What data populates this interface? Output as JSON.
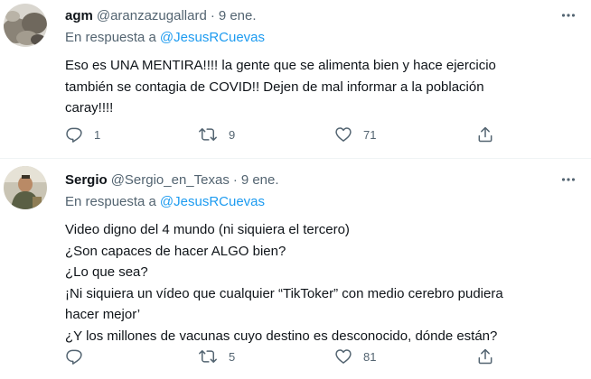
{
  "tweets": [
    {
      "name": "agm",
      "handle": "@aranzazugallard",
      "separator": "·",
      "date": "9 ene.",
      "reply_prefix": "En respuesta a",
      "reply_to": "@JesusRCuevas",
      "text": "Eso es UNA MENTIRA!!!! la gente que se alimenta bien y hace ejercicio\ntambién se contagia de COVID!! Dejen de mal informar a la población\ncaray!!!!",
      "replies": "1",
      "retweets": "9",
      "likes": "71",
      "icons": {
        "reply": "reply-icon",
        "retweet": "retweet-icon",
        "like": "heart-icon",
        "share": "share-icon",
        "more": "more-icon"
      }
    },
    {
      "name": "Sergio",
      "handle": "@Sergio_en_Texas",
      "separator": "·",
      "date": "9 ene.",
      "reply_prefix": "En respuesta a",
      "reply_to": "@JesusRCuevas",
      "text": "Video digno del 4 mundo (ni siquiera el tercero)\n¿Son capaces de hacer ALGO bien?\n¿Lo que sea?\n¡Ni siquiera un vídeo que cualquier “TikToker” con medio cerebro pudiera\nhacer mejor’\n¿Y los millones de vacunas cuyo destino es desconocido, dónde están?",
      "replies": "",
      "retweets": "5",
      "likes": "81",
      "icons": {
        "reply": "reply-icon",
        "retweet": "retweet-icon",
        "like": "heart-icon",
        "share": "share-icon",
        "more": "more-icon"
      }
    }
  ],
  "colors": {
    "text": "#0f1419",
    "secondary": "#536471",
    "link": "#1d9bf0",
    "divider": "#eff3f4"
  }
}
